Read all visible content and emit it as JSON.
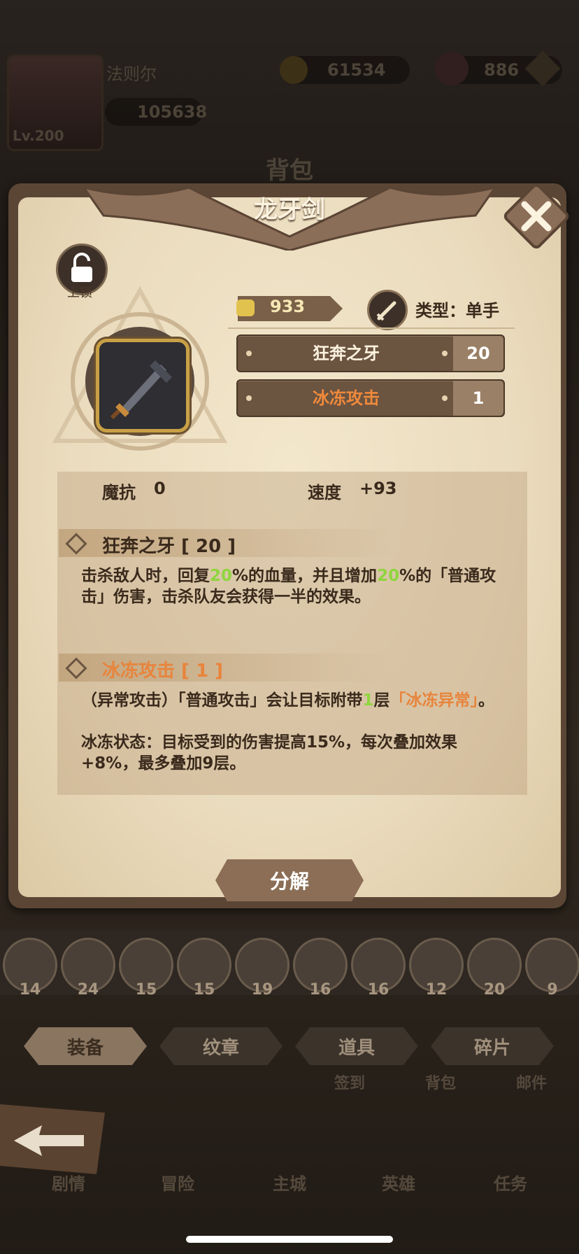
{
  "hud": {
    "player_name": "法则尔",
    "level": "Lv.200",
    "power": "105638",
    "gold": "61534",
    "gems": "886"
  },
  "background_title": "背包",
  "dialog": {
    "title": "龙牙剑",
    "lock_label": "上锁",
    "power": "933",
    "type_label": "类型：单手",
    "skills": [
      {
        "name": "狂奔之牙",
        "level": "20",
        "color": "#3a2a1c"
      },
      {
        "name": "冰冻攻击",
        "level": "1",
        "color": "#e8843c"
      }
    ],
    "stats": {
      "magic_res_label": "魔抗",
      "magic_res_value": "0",
      "speed_label": "速度",
      "speed_value": "+93"
    },
    "sections": [
      {
        "title": "狂奔之牙 [ 20 ]",
        "desc_parts": [
          "击杀敌人时，回复",
          "20",
          "%的血量，并且增加",
          "20",
          "%的「普通攻击」伤害，击杀队友会获得一半的效果。"
        ]
      },
      {
        "title": "冰冻攻击 [ 1 ]",
        "desc_parts": [
          "（异常攻击）「普通攻击」会让目标附带",
          "1",
          "层",
          "「冰冻异常」",
          "。"
        ],
        "desc_line2": "冰冻状态：目标受到的伤害提高15%，每次叠加效果+8%，最多叠加9层。"
      }
    ],
    "decompose_label": "分解"
  },
  "categories": [
    {
      "icon": "bow-icon",
      "count": "14"
    },
    {
      "icon": "sword-icon",
      "count": "24"
    },
    {
      "icon": "spear-icon",
      "count": "15"
    },
    {
      "icon": "gauntlet-icon",
      "count": "15"
    },
    {
      "icon": "helmet-icon",
      "count": "19"
    },
    {
      "icon": "shield-icon",
      "count": "16"
    },
    {
      "icon": "armor-icon",
      "count": "16"
    },
    {
      "icon": "amulet-icon",
      "count": "12"
    },
    {
      "icon": "book-icon",
      "count": "20"
    },
    {
      "icon": "orb-icon",
      "count": "9"
    }
  ],
  "tabs": [
    "装备",
    "纹章",
    "道具",
    "碎片"
  ],
  "ghost_labels": [
    "签到",
    "背包",
    "邮件"
  ],
  "nav": [
    "剧情",
    "冒险",
    "主城",
    "英雄",
    "任务"
  ]
}
